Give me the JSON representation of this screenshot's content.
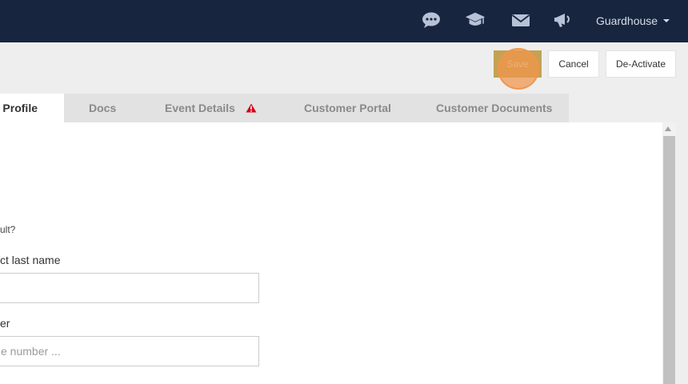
{
  "topbar": {
    "icons": [
      "chat-icon",
      "graduation-cap-icon",
      "envelope-icon",
      "megaphone-icon"
    ],
    "user_name": "Guardhouse",
    "bg_color": "#17253f"
  },
  "actions": {
    "save_label": "Save",
    "cancel_label": "Cancel",
    "deactivate_label": "De-Activate"
  },
  "tabs": [
    {
      "label": "e Profile",
      "active": true
    },
    {
      "label": "Docs"
    },
    {
      "label": "Event Details",
      "alert": true
    },
    {
      "label": "Customer Portal"
    },
    {
      "label": "Customer Documents"
    }
  ],
  "form": {
    "question_text": "ult?",
    "last_name_label": "ct last name",
    "last_name_value": "",
    "number_label": "er",
    "number_placeholder": "e number ..."
  },
  "colors": {
    "save_button": "#c4a253",
    "alert_icon": "#d0021b",
    "click_highlight": "#f0964b"
  }
}
